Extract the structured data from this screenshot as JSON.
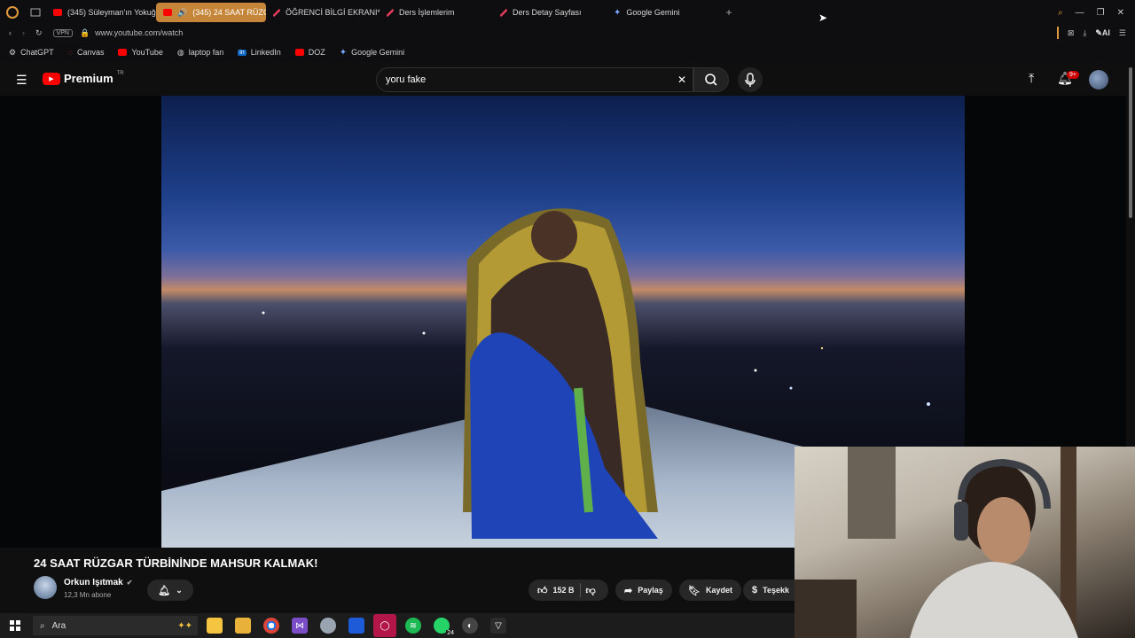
{
  "browser": {
    "tabs": [
      {
        "label": "(345) Süleyman'ın Yokuğu",
        "icon": "youtube-icon",
        "active": false
      },
      {
        "label": "(345) 24 SAAT RÜZGA",
        "icon": "youtube-icon",
        "active": true
      },
      {
        "label": "ÖĞRENCİ BİLGİ EKRANI*",
        "icon": "slash-icon",
        "active": false
      },
      {
        "label": "Ders İşlemlerim",
        "icon": "slash-icon",
        "active": false
      },
      {
        "label": "Ders Detay Sayfası",
        "icon": "slash-icon",
        "active": false
      },
      {
        "label": "Google Gemini",
        "icon": "gemini-icon",
        "active": false
      }
    ],
    "vpn_label": "VPN",
    "url": "www.youtube.com/watch",
    "ai_label": "AI",
    "bookmarks": [
      {
        "label": "ChatGPT"
      },
      {
        "label": "Canvas"
      },
      {
        "label": "YouTube"
      },
      {
        "label": "laptop fan"
      },
      {
        "label": "LinkedIn"
      },
      {
        "label": "DOZ"
      },
      {
        "label": "Google Gemini"
      }
    ]
  },
  "youtube": {
    "logo_text": "Premium",
    "logo_region": "TR",
    "search_value": "yoru fake",
    "notification_count": "9+",
    "video": {
      "title": "24 SAAT RÜZGAR TÜRBİNİNDE MAHSUR KALMAK!",
      "channel": "Orkun Işıtmak",
      "subscribers": "12,3 Mn abone",
      "likes": "152 B",
      "share_label": "Paylaş",
      "save_label": "Kaydet",
      "thanks_label": "Teşekk"
    }
  },
  "taskbar": {
    "search_placeholder": "Ara",
    "whatsapp_badge": "24"
  },
  "colors": {
    "youtube_red": "#ff0000",
    "active_tab": "#c6863a",
    "background": "#0f0f0f"
  }
}
